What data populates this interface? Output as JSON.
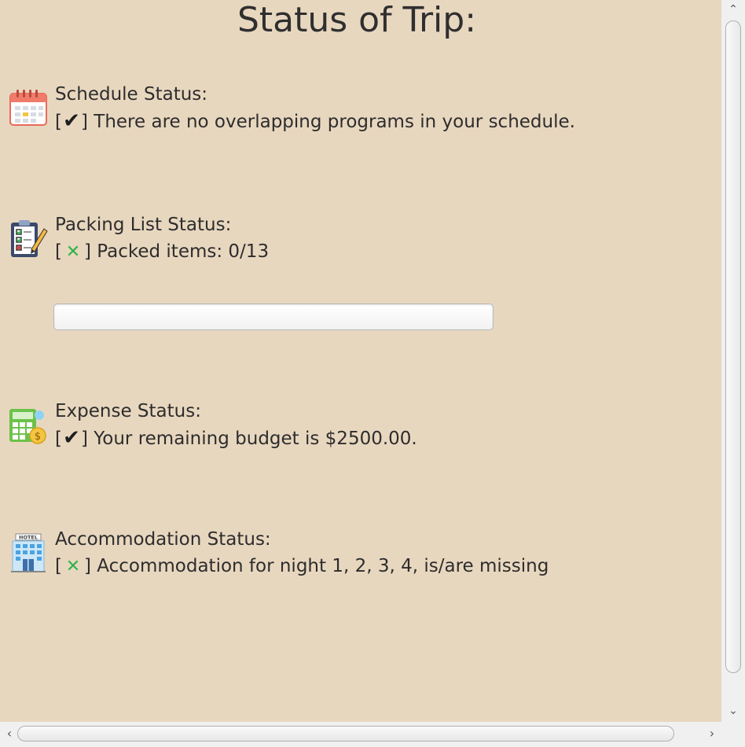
{
  "title": "Status of Trip:",
  "sections": {
    "schedule": {
      "icon": "calendar-icon",
      "label": "Schedule Status:",
      "bracket_open": "[",
      "mark": "✔",
      "bracket_close": "]",
      "message": " There are no overlapping programs in your schedule."
    },
    "packing": {
      "icon": "checklist-clipboard-icon",
      "label": "Packing List Status:",
      "bracket_open": "[",
      "mark": "✕",
      "bracket_close": "]",
      "message": " Packed items: 0/13",
      "progress": 0
    },
    "expense": {
      "icon": "calculator-money-icon",
      "label": "Expense Status:",
      "bracket_open": "[",
      "mark": "✔",
      "bracket_close": "]",
      "message": " Your remaining budget is $2500.00."
    },
    "accommodation": {
      "icon": "hotel-icon",
      "label": "Accommodation Status:",
      "bracket_open": "[",
      "mark": "✕",
      "bracket_close": "]",
      "message": " Accommodation for night 1, 2, 3, 4, is/are missing",
      "hotel_sign": "HOTEL"
    }
  },
  "colors": {
    "background": "#e8d7bf",
    "cross_mark": "#2fb34a",
    "check_mark": "#1e1e1e"
  },
  "scrollbar": {
    "up": "⌃",
    "down": "⌄",
    "left": "‹",
    "right": "›"
  }
}
